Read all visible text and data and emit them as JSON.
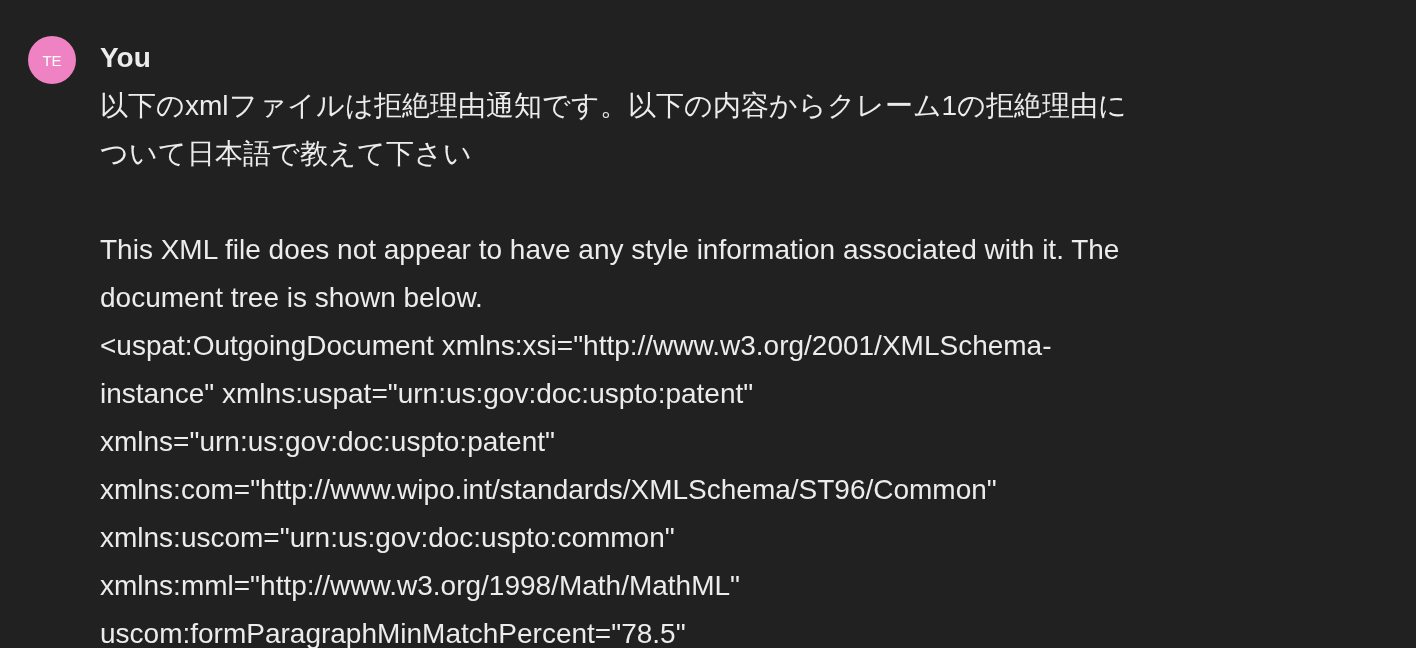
{
  "message": {
    "avatar": "TE",
    "author": "You",
    "paragraphs": [
      [
        "以下のxmlファイルは拒絶理由通知です。以下の内容からクレーム1の拒絶理由に",
        "ついて日本語で教えて下さい"
      ],
      [
        "This XML file does not appear to have any style information associated with it. The",
        "document tree is shown below.",
        "<uspat:OutgoingDocument xmlns:xsi=\"http://www.w3.org/2001/XMLSchema-",
        "instance\" xmlns:uspat=\"urn:us:gov:doc:uspto:patent\"",
        "xmlns=\"urn:us:gov:doc:uspto:patent\"",
        "xmlns:com=\"http://www.wipo.int/standards/XMLSchema/ST96/Common\"",
        "xmlns:uscom=\"urn:us:gov:doc:uspto:common\"",
        "xmlns:mml=\"http://www.w3.org/1998/Math/MathML\"",
        "uscom:formParagraphMinMatchPercent=\"78.5\""
      ]
    ]
  }
}
